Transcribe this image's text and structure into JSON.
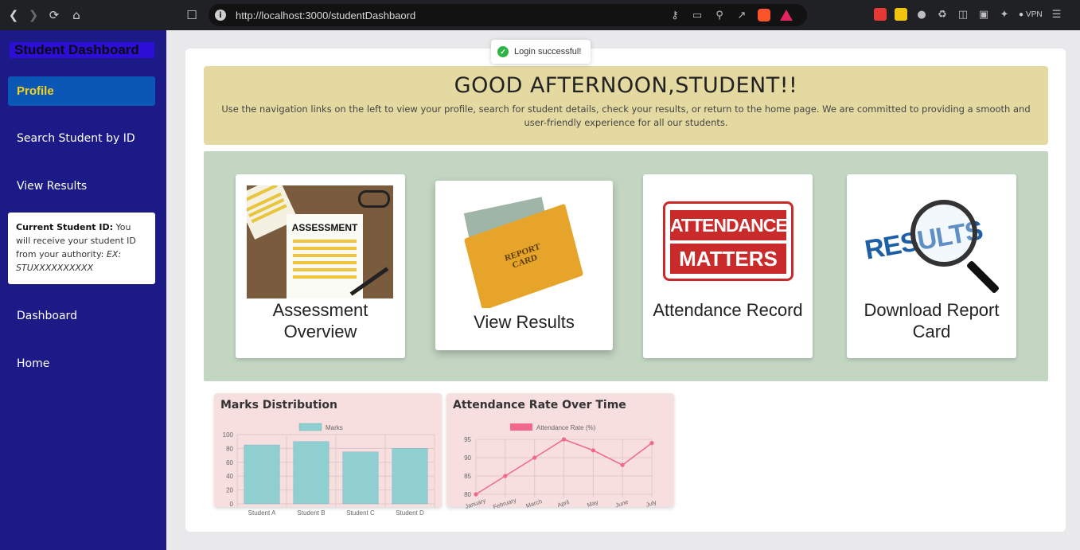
{
  "browser": {
    "url": "http://localhost:3000/studentDashbaord",
    "vpn_label": "VPN"
  },
  "sidebar": {
    "title": "Student Dashboard",
    "items": [
      {
        "label": "Profile"
      },
      {
        "label": "Search Student by ID"
      },
      {
        "label": "View Results"
      },
      {
        "label": "Dashboard"
      },
      {
        "label": "Home"
      }
    ],
    "id_card": {
      "label": "Current Student ID:",
      "text": "You will receive your student ID from your authority:",
      "example": "EX: STUXXXXXXXXXX"
    }
  },
  "toast": {
    "message": "Login successful!"
  },
  "banner": {
    "heading": "GOOD AFTERNOON,STUDENT!!",
    "description": "Use the navigation links on the left to view your profile, search for student details, check your results, or return to the home page. We are committed to providing a smooth and user-friendly experience for all our students."
  },
  "cards": [
    {
      "label": "Assessment Overview",
      "image_text": "ASSESSMENT"
    },
    {
      "label": "View Results",
      "image_text": "REPORT CARD"
    },
    {
      "label": "Attendance Record",
      "image_text_1": "ATTENDANCE",
      "image_text_2": "MATTERS"
    },
    {
      "label": "Download Report Card",
      "image_text": "RESULTS"
    }
  ],
  "chart_data": [
    {
      "type": "bar",
      "title": "Marks Distribution",
      "legend": "Marks",
      "categories": [
        "Student A",
        "Student B",
        "Student C",
        "Student D"
      ],
      "values": [
        85,
        90,
        75,
        80
      ],
      "ylim": [
        0,
        100
      ],
      "yticks": [
        0,
        20,
        40,
        60,
        80,
        100
      ],
      "color": "#8fcfcf"
    },
    {
      "type": "line",
      "title": "Attendance Rate Over Time",
      "legend": "Attendance Rate (%)",
      "categories": [
        "January",
        "February",
        "March",
        "April",
        "May",
        "June",
        "July"
      ],
      "values": [
        80,
        85,
        90,
        95,
        92,
        88,
        94
      ],
      "ylim": [
        80,
        95
      ],
      "yticks": [
        80,
        85,
        90,
        95
      ],
      "color": "#f2688a"
    }
  ]
}
